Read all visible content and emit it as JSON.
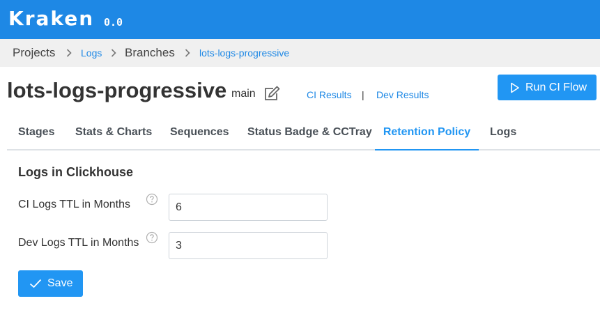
{
  "app": {
    "name": "Kraken",
    "version": "0.0"
  },
  "breadcrumb": {
    "projects": "Projects",
    "project": "Logs",
    "branches": "Branches",
    "branch": "lots-logs-progressive"
  },
  "header": {
    "title": "lots-logs-progressive",
    "branch_name": "main",
    "ci_results": "CI Results",
    "separator": "|",
    "dev_results": "Dev Results",
    "run_button": "Run CI Flow"
  },
  "tabs": [
    {
      "label": "Stages",
      "active": false
    },
    {
      "label": "Stats & Charts",
      "active": false
    },
    {
      "label": "Sequences",
      "active": false
    },
    {
      "label": "Status Badge & CCTray",
      "active": false
    },
    {
      "label": "Retention Policy",
      "active": true
    },
    {
      "label": "Logs",
      "active": false
    }
  ],
  "retention": {
    "section_title": "Logs in Clickhouse",
    "ci_label": "CI Logs TTL in Months",
    "ci_value": "6",
    "dev_label": "Dev Logs TTL in Months",
    "dev_value": "3",
    "save_button": "Save"
  },
  "icons": {
    "crumb_separator": "chevron-right-icon",
    "edit": "edit-icon",
    "run": "play-icon",
    "help": "help-icon",
    "save": "check-icon"
  },
  "colors": {
    "topbar": "#1e88e5",
    "primary": "#2196f3",
    "link": "#1e88e5",
    "breadcrumb_bg": "#f0f0f0"
  }
}
